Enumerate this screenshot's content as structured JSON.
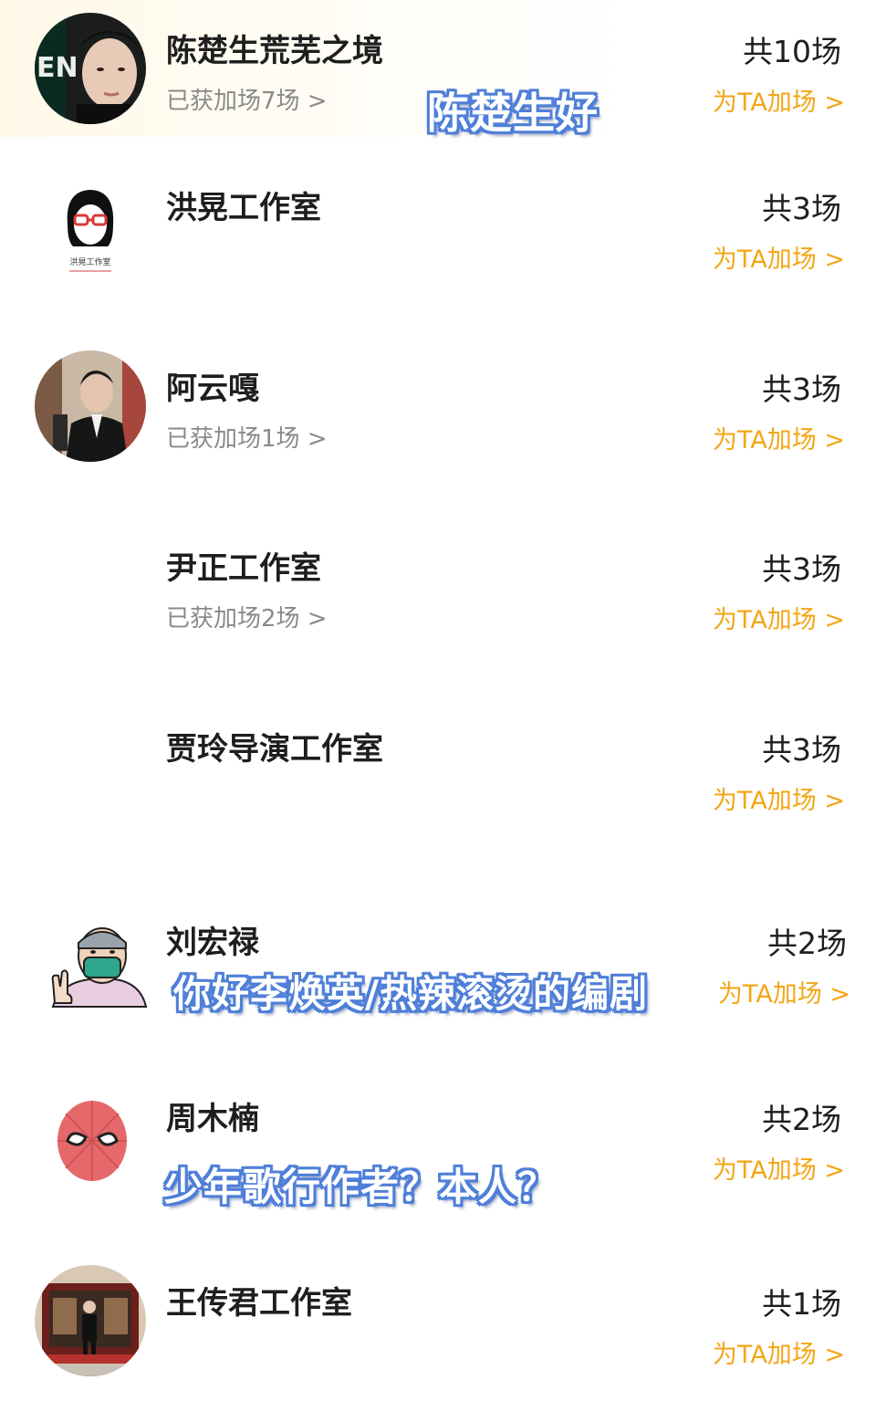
{
  "rows": [
    {
      "name": "陈楚生荒芜之境",
      "gained": "已获加场7场 >",
      "total": "共10场",
      "boost_label": "为TA加场 >",
      "avatar_icon": "portrait-photo"
    },
    {
      "name": "洪晃工作室",
      "gained": "",
      "total": "共3场",
      "boost_label": "为TA加场 >",
      "avatar_icon": "studio-logo",
      "avatar_text": "洪晃工作室"
    },
    {
      "name": "阿云嘎",
      "gained": "已获加场1场 >",
      "total": "共3场",
      "boost_label": "为TA加场 >",
      "avatar_icon": "portrait-photo"
    },
    {
      "name": "尹正工作室",
      "gained": "已获加场2场 >",
      "total": "共3场",
      "boost_label": "为TA加场 >",
      "avatar_icon": "blank-avatar"
    },
    {
      "name": "贾玲导演工作室",
      "gained": "",
      "total": "共3场",
      "boost_label": "为TA加场 >",
      "avatar_icon": "blank-avatar"
    },
    {
      "name": "刘宏禄",
      "gained": "",
      "total": "共2场",
      "boost_label": "为TA加场 >",
      "avatar_icon": "cartoon-masked-person"
    },
    {
      "name": "周木楠",
      "gained": "",
      "total": "共2场",
      "boost_label": "为TA加场 >",
      "avatar_icon": "spiderman-mask"
    },
    {
      "name": "王传君工作室",
      "gained": "",
      "total": "共1场",
      "boost_label": "为TA加场 >",
      "avatar_icon": "stage-photo"
    }
  ],
  "captions": {
    "caption_1": "陈楚生好",
    "caption_2": "你好李焕英/热辣滚烫的编剧",
    "caption_3": "少年歌行作者？本人？"
  },
  "colors": {
    "accent": "#f2a615",
    "caption_outline": "#4f7fd8",
    "name_text": "#1e1e1e",
    "secondary_text": "#8a8a8a"
  }
}
